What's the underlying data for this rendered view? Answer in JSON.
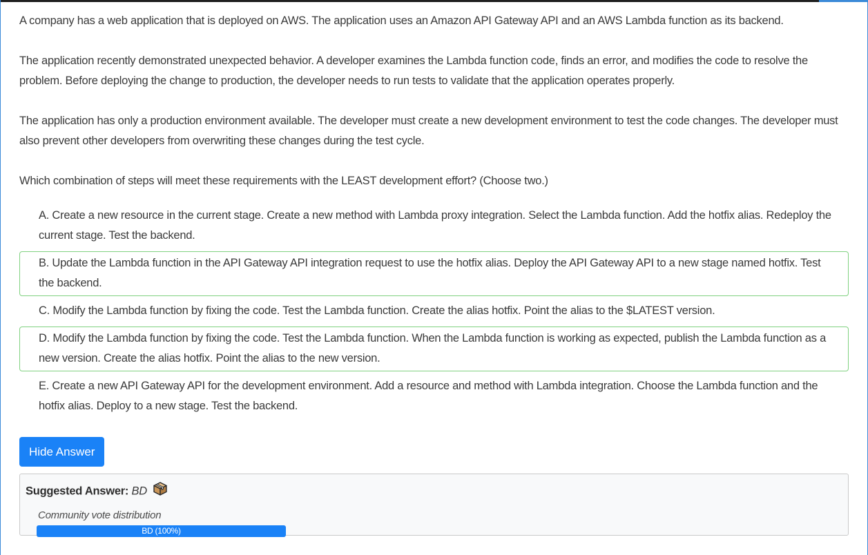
{
  "question": {
    "paragraphs": [
      "A company has a web application that is deployed on AWS. The application uses an Amazon API Gateway API and an AWS Lambda function as its backend.",
      "The application recently demonstrated unexpected behavior. A developer examines the Lambda function code, finds an error, and modifies the code to resolve the problem. Before deploying the change to production, the developer needs to run tests to validate that the application operates properly.",
      "The application has only a production environment available. The developer must create a new development environment to test the code changes. The developer must also prevent other developers from overwriting these changes during the test cycle.",
      "Which combination of steps will meet these requirements with the LEAST development effort? (Choose two.)"
    ],
    "choices": [
      {
        "text": "A. Create a new resource in the current stage. Create a new method with Lambda proxy integration. Select the Lambda function. Add the hotfix alias. Redeploy the current stage. Test the backend.",
        "correct": false
      },
      {
        "text": "B. Update the Lambda function in the API Gateway API integration request to use the hotfix alias. Deploy the API Gateway API to a new stage named hotfix. Test the backend.",
        "correct": true
      },
      {
        "text": "C. Modify the Lambda function by fixing the code. Test the Lambda function. Create the alias hotfix. Point the alias to the $LATEST version.",
        "correct": false
      },
      {
        "text": "D. Modify the Lambda function by fixing the code. Test the Lambda function. When the Lambda function is working as expected, publish the Lambda function as a new version. Create the alias hotfix. Point the alias to the new version.",
        "correct": true
      },
      {
        "text": "E. Create a new API Gateway API for the development environment. Add a resource and method with Lambda integration. Choose the Lambda function and the hotfix alias. Deploy to a new stage. Test the backend.",
        "correct": false
      }
    ]
  },
  "hide_answer_label": "Hide Answer",
  "answer": {
    "label": "Suggested Answer:",
    "value": "BD",
    "icon": "package-box-icon"
  },
  "vote": {
    "label": "Community vote distribution",
    "bar_text": "BD (100%)",
    "percent": 100
  },
  "colors": {
    "accent": "#1a82f7",
    "correct_border": "#7fd17f",
    "window_border": "#3b8ad8"
  }
}
